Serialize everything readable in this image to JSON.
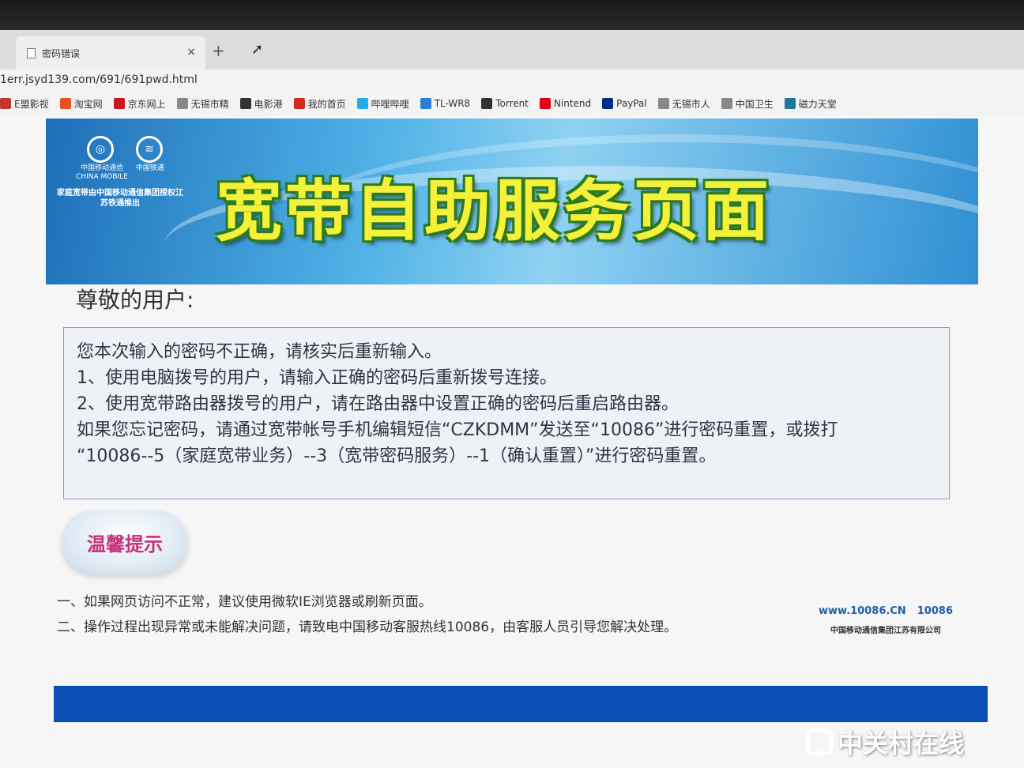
{
  "browser": {
    "tab_title": "密码错误",
    "address": "1err.jsyd139.com/691/691pwd.html",
    "bookmarks": [
      {
        "label": "E盟影视",
        "icon": "film-icon",
        "color": "#c0392b"
      },
      {
        "label": "淘宝网",
        "icon": "taobao-icon",
        "color": "#e8521f"
      },
      {
        "label": "京东网上",
        "icon": "jd-icon",
        "color": "#c81623"
      },
      {
        "label": "无锡市精",
        "icon": "page-icon",
        "color": "#888888"
      },
      {
        "label": "电影港",
        "icon": "movie-icon",
        "color": "#333333"
      },
      {
        "label": "我的首页",
        "icon": "weibo-icon",
        "color": "#d52b1e"
      },
      {
        "label": "哔哩哔哩",
        "icon": "bilibili-icon",
        "color": "#23ade5"
      },
      {
        "label": "TL-WR8",
        "icon": "tplink-icon",
        "color": "#2a7fd4"
      },
      {
        "label": "Torrent",
        "icon": "torrent-icon",
        "color": "#333333"
      },
      {
        "label": "Nintend",
        "icon": "nintendo-icon",
        "color": "#e60012"
      },
      {
        "label": "PayPal",
        "icon": "paypal-icon",
        "color": "#003087"
      },
      {
        "label": "无锡市人",
        "icon": "page-icon",
        "color": "#888888"
      },
      {
        "label": "中国卫生",
        "icon": "page-icon",
        "color": "#888888"
      },
      {
        "label": "磁力天堂",
        "icon": "wordpress-icon",
        "color": "#21759b"
      }
    ]
  },
  "banner": {
    "logo1_name": "中国移动通信",
    "logo1_en": "CHINA MOBILE",
    "logo2_name": "中国铁通",
    "caption": "家庭宽带由中国移动通信集团授权江苏铁通推出",
    "title": "宽带自助服务页面"
  },
  "content": {
    "greeting": "尊敬的用户:",
    "message_lines": [
      "您本次输入的密码不正确，请核实后重新输入。",
      "1、使用电脑拨号的用户，请输入正确的密码后重新拨号连接。",
      "2、使用宽带路由器拨号的用户，请在路由器中设置正确的密码后重启路由器。",
      "如果您忘记密码，请通过宽带帐号手机编辑短信“CZKDMM”发送至“10086”进行密码重置，或拨打",
      "“10086--5（家庭宽带业务）--3（宽带密码服务）--1（确认重置）”进行密码重置。"
    ],
    "tip_title": "温馨提示",
    "tips": [
      "一、如果网页访问不正常，建议使用微软IE浏览器或刷新页面。",
      "二、操作过程出现异常或未能解决问题，请致电中国移动客服热线10086，由客服人员引导您解决处理。"
    ]
  },
  "footer": {
    "site": "www.10086.CN",
    "hotline": "10086",
    "company": "中国移动通信集团江苏有限公司"
  },
  "watermark": "中关村在线",
  "colors": {
    "banner_title": "#f5f03a",
    "footer_bar": "#0a50b4",
    "tip_text": "#c8307a"
  }
}
